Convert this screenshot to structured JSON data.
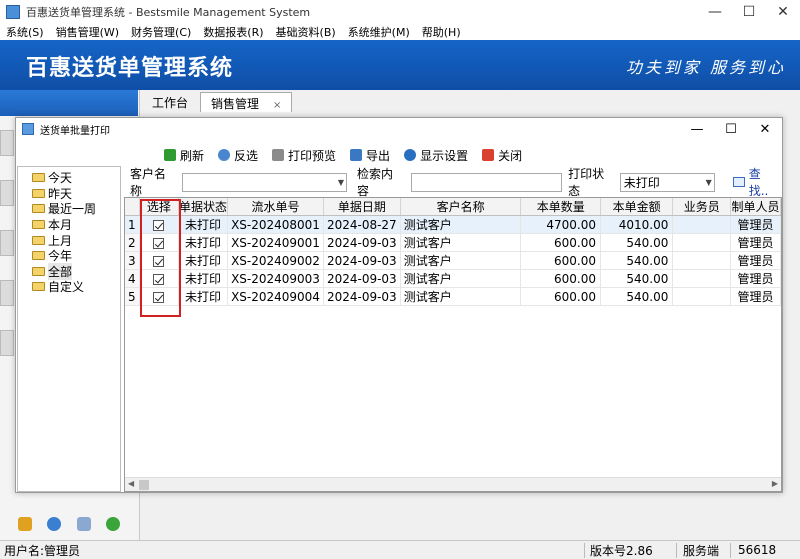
{
  "window": {
    "title": "百惠送货单管理系统 - Bestsmile Management System",
    "min": "—",
    "max": "☐",
    "close": "✕"
  },
  "menu": [
    "系统(S)",
    "销售管理(W)",
    "财务管理(C)",
    "数据报表(R)",
    "基础资料(B)",
    "系统维护(M)",
    "帮助(H)"
  ],
  "banner": {
    "title": "百惠送货单管理系统",
    "slogan": "功夫到家 服务到心"
  },
  "tabs": {
    "workbench": "工作台",
    "sales": "销售管理",
    "close": "×"
  },
  "dialog": {
    "title": "送货单批量打印",
    "toolbar": {
      "refresh": "刷新",
      "invert": "反选",
      "preview": "打印预览",
      "export": "导出",
      "display": "显示设置",
      "close": "关闭"
    },
    "tree": [
      "今天",
      "昨天",
      "最近一周",
      "本月",
      "上月",
      "今年",
      "全部",
      "自定义"
    ],
    "tree_selected": "全部",
    "filter": {
      "customer_label": "客户名称",
      "customer_value": "",
      "search_label": "检索内容",
      "search_value": "",
      "print_status_label": "打印状态",
      "print_status_value": "未打印",
      "search_button": "查找.."
    },
    "columns": [
      "选择",
      "单据状态",
      "流水单号",
      "单据日期",
      "客户名称",
      "本单数量",
      "本单金额",
      "业务员",
      "制单人员"
    ],
    "rows": [
      {
        "n": "1",
        "status": "未打印",
        "serial": "XS-202408001",
        "date": "2024-08-27",
        "customer": "测试客户",
        "qty": "4700.00",
        "amount": "4010.00",
        "salesman": "",
        "maker": "管理员"
      },
      {
        "n": "2",
        "status": "未打印",
        "serial": "XS-202409001",
        "date": "2024-09-03",
        "customer": "测试客户",
        "qty": "600.00",
        "amount": "540.00",
        "salesman": "",
        "maker": "管理员"
      },
      {
        "n": "3",
        "status": "未打印",
        "serial": "XS-202409002",
        "date": "2024-09-03",
        "customer": "测试客户",
        "qty": "600.00",
        "amount": "540.00",
        "salesman": "",
        "maker": "管理员"
      },
      {
        "n": "4",
        "status": "未打印",
        "serial": "XS-202409003",
        "date": "2024-09-03",
        "customer": "测试客户",
        "qty": "600.00",
        "amount": "540.00",
        "salesman": "",
        "maker": "管理员"
      },
      {
        "n": "5",
        "status": "未打印",
        "serial": "XS-202409004",
        "date": "2024-09-03",
        "customer": "测试客户",
        "qty": "600.00",
        "amount": "540.00",
        "salesman": "",
        "maker": "管理员"
      }
    ]
  },
  "status": {
    "user": "用户名:管理员",
    "version": "版本号2.86",
    "server": "服务端",
    "count": "56618"
  },
  "colors": {
    "banner": "#1565c8",
    "highlight": "#d02020",
    "selected_row": "#e6f1fb"
  }
}
